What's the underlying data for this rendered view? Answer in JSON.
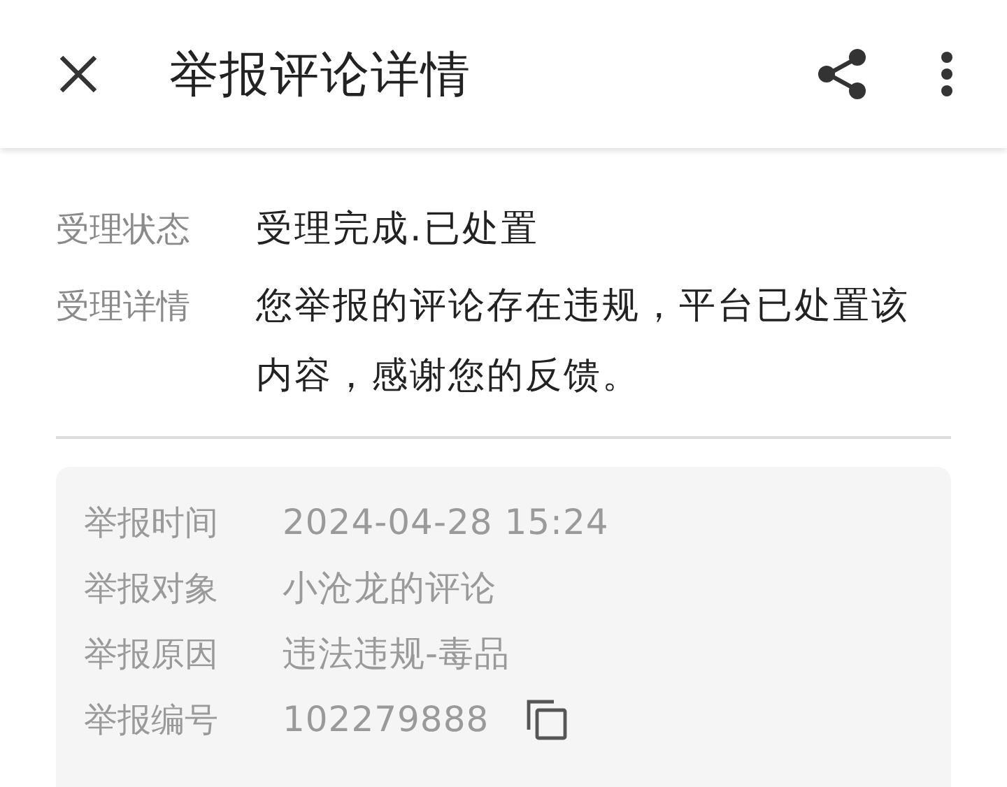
{
  "header": {
    "title": "举报评论详情"
  },
  "status": [
    {
      "label": "受理状态",
      "value": "受理完成.已处置"
    },
    {
      "label": "受理详情",
      "value": "您举报的评论存在违规，平台已处置该内容，感谢您的反馈。"
    }
  ],
  "report": [
    {
      "label": "举报时间",
      "value": "2024-04-28 15:24",
      "kind": "text"
    },
    {
      "label": "举报对象",
      "value": "小沧龙的评论",
      "kind": "text"
    },
    {
      "label": "举报原因",
      "value": "违法违规-毒品",
      "kind": "text"
    },
    {
      "label": "举报编号",
      "value": "102279888",
      "kind": "copyable"
    }
  ]
}
